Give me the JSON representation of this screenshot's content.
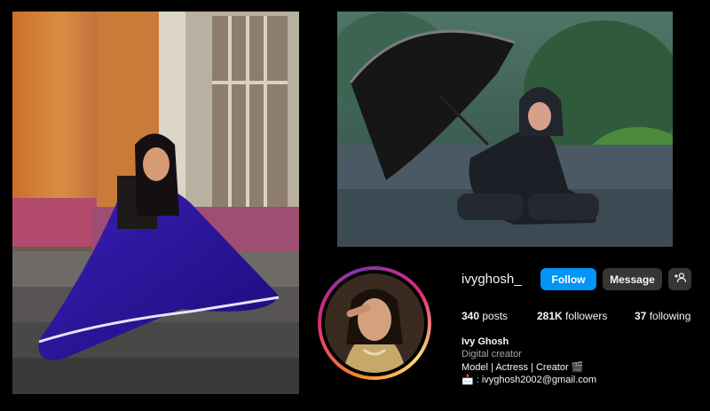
{
  "profile": {
    "username": "ivyghosh_",
    "follow_label": "Follow",
    "message_label": "Message",
    "adduser_icon": "add-user-icon",
    "posts_count": "340",
    "posts_label": "posts",
    "followers_count": "281K",
    "followers_label": "followers",
    "following_count": "37",
    "following_label": "following",
    "display_name": "Ivy Ghosh",
    "category": "Digital creator",
    "bio_line": "Model | Actress | Creator 🎬",
    "email_line": "📩 : ivyghosh2002@gmail.com"
  },
  "colors": {
    "background": "#000000",
    "follow_button": "#0095f6",
    "secondary_button": "#363636",
    "muted_text": "#a8a8a8"
  }
}
